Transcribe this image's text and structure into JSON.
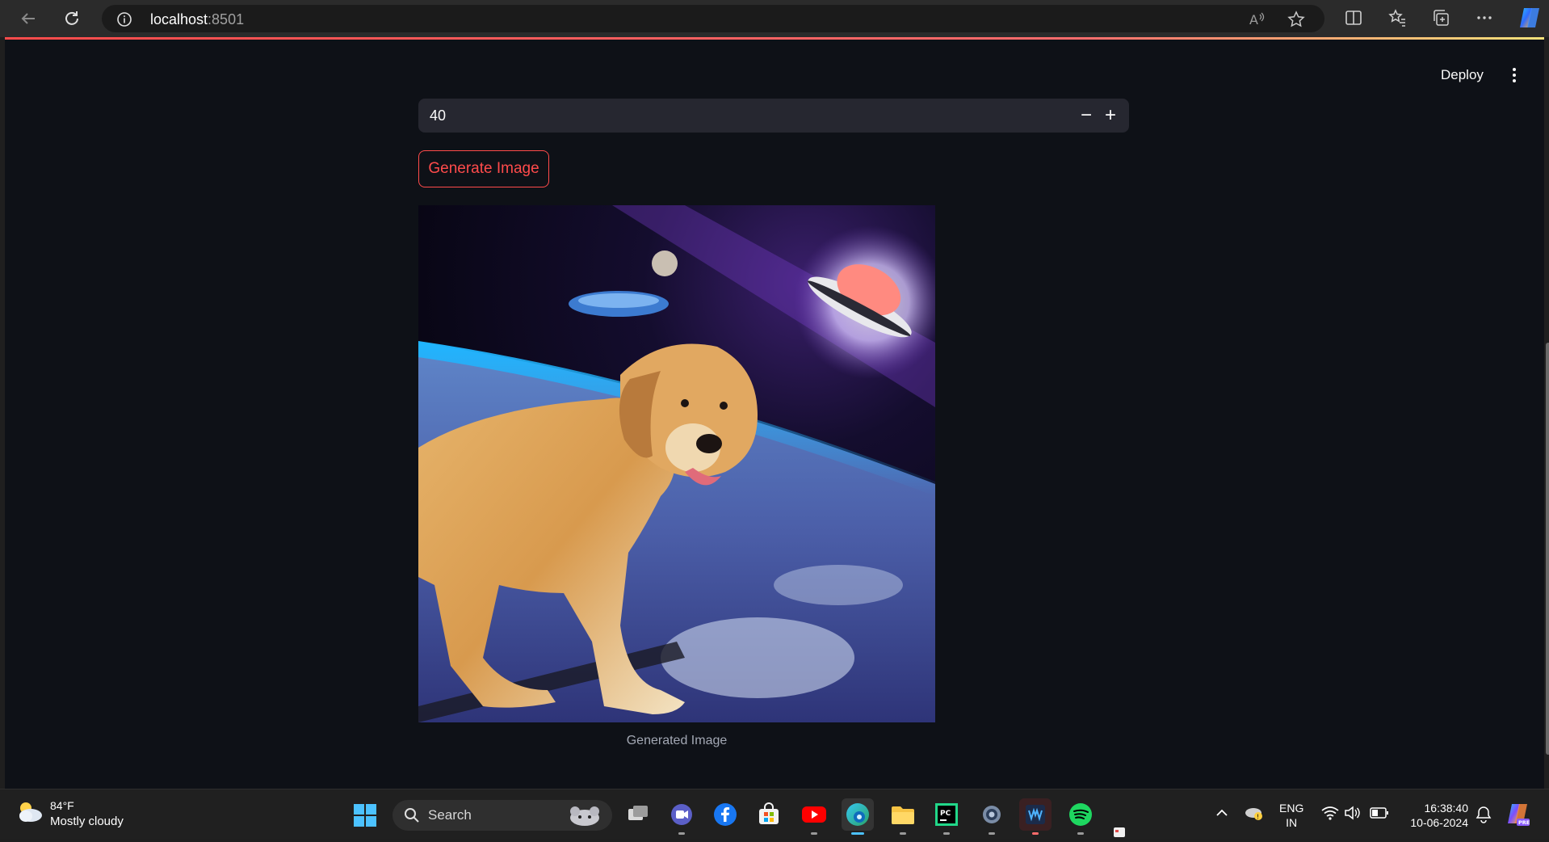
{
  "browser": {
    "url_host": "localhost",
    "url_port": ":8501"
  },
  "app": {
    "deploy_label": "Deploy",
    "number_input": {
      "value": "40",
      "decrement": "−",
      "increment": "+"
    },
    "generate_button": "Generate Image",
    "image_caption": "Generated Image"
  },
  "taskbar": {
    "weather_temp": "84°F",
    "weather_condition": "Mostly cloudy",
    "search_label": "Search",
    "language_top": "ENG",
    "language_bottom": "IN",
    "time": "16:38:40",
    "date": "10-06-2024",
    "apps": [
      "task-view",
      "teams",
      "facebook",
      "microsoft-store",
      "youtube",
      "edge",
      "file-explorer",
      "pycharm",
      "settings",
      "audio-app",
      "spotify"
    ]
  },
  "colors": {
    "accent": "#ff4b4b",
    "app_bg": "#0e1117",
    "input_bg": "#262730"
  }
}
